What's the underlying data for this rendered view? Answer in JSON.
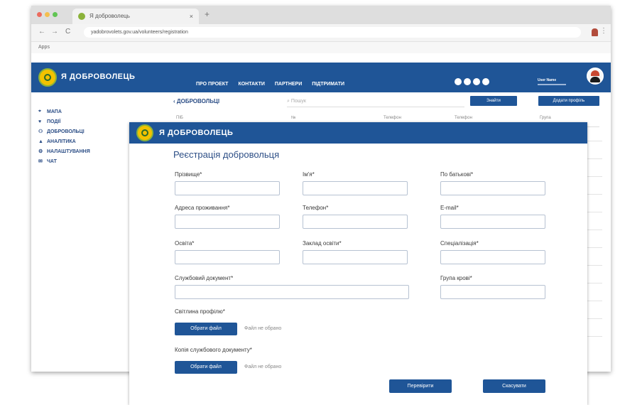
{
  "browser": {
    "tab_title": "Я доброволець",
    "tab_close": "×",
    "new_tab": "+",
    "url": "yadobrovolets.gov.ua/volunteers/registration",
    "bookmarks_label": "Apps",
    "back": "←",
    "forward": "→",
    "reload": "C",
    "menu": "⋮",
    "dot_colors": [
      "#ec6b5e",
      "#f4bf4f",
      "#61c554"
    ]
  },
  "app": {
    "brand": "Я ДОБРОВОЛЕЦЬ",
    "menu": [
      "ПРО ПРОЕКТ",
      "КОНТАКТИ",
      "ПАРТНЕРИ",
      "ПІДТРИМАТИ"
    ],
    "user_name": "User Name",
    "colors": {
      "primary": "#1f5597",
      "logo_yellow": "#f2c200",
      "logo_green": "#8bb23a"
    }
  },
  "sidebar": {
    "items": [
      {
        "icon": "map-icon",
        "glyph": "⌖",
        "label": "МАПА"
      },
      {
        "icon": "events-icon",
        "glyph": "♥",
        "label": "ПОДІЇ"
      },
      {
        "icon": "volunteers-icon",
        "glyph": "⚇",
        "label": "ДОБРОВОЛЬЦІ"
      },
      {
        "icon": "analytics-icon",
        "glyph": "▲",
        "label": "АНАЛІТИКА"
      },
      {
        "icon": "settings-icon",
        "glyph": "⚙",
        "label": "НАЛАШТУВАННЯ"
      },
      {
        "icon": "chat-icon",
        "glyph": "✉",
        "label": "ЧАТ"
      }
    ]
  },
  "main": {
    "breadcrumb": "ДОБРОВОЛЬЦІ",
    "breadcrumb_arrow": "‹",
    "search_placeholder": "Пошук",
    "find_button": "Знайти",
    "add_button": "Додати профіль",
    "columns": [
      "ПІБ",
      "№",
      "Телефон",
      "Телефон",
      "Група"
    ]
  },
  "modal": {
    "brand": "Я ДОБРОВОЛЕЦЬ",
    "title": "Реєстрація добровольця",
    "fields": {
      "surname": "Прізвище*",
      "name": "Ім'я*",
      "patronymic": "По батькові*",
      "address": "Адреса проживання*",
      "phone": "Телефон*",
      "email": "E-mail*",
      "education": "Освіта*",
      "institution": "Заклад освіти*",
      "specialization": "Спеціалізація*",
      "service_doc": "Службовий документ*",
      "blood_group": "Група крові*"
    },
    "photo_label": "Світлина профілю*",
    "doc_copy_label": "Копія службового документу*",
    "choose_file": "Обрати файл",
    "no_file": "Файл не обрано",
    "check_button": "Перевірити",
    "cancel_button": "Скасувати"
  }
}
